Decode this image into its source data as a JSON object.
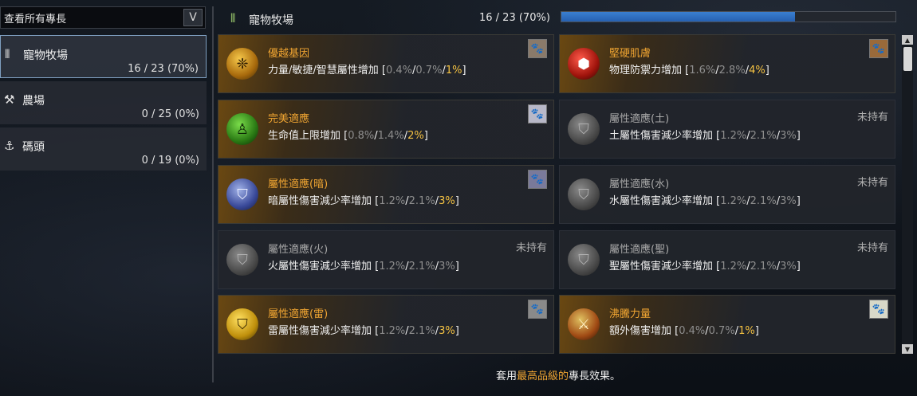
{
  "filter": {
    "label": "查看所有專長",
    "arrow": "V"
  },
  "categories": [
    {
      "icon": "pet-ranch-icon",
      "glyph": "⫴",
      "label": "寵物牧場",
      "count": "16 / 23 (70%)"
    },
    {
      "icon": "farm-icon",
      "glyph": "⚒",
      "label": "農場",
      "count": "0 / 25 (0%)"
    },
    {
      "icon": "anchor-icon",
      "glyph": "⚓",
      "label": "碼頭",
      "count": "0 / 19 (0%)"
    }
  ],
  "header": {
    "title": "寵物牧場",
    "count": "16 / 23 (70%)",
    "progress": 0.7
  },
  "cards": [
    {
      "name": "優越基因",
      "owned": true,
      "effect": "力量/敏捷/智慧屬性增加",
      "v1": "0.4%",
      "v2": "0.7%",
      "v3": "1%",
      "icon": "gene-icon",
      "thumb": "pet-thumb-owl-icon"
    },
    {
      "name": "堅硬肌膚",
      "owned": true,
      "effect": "物理防禦力增加",
      "v1": "1.6%",
      "v2": "2.8%",
      "v3": "4%",
      "icon": "red-gem-icon",
      "thumb": "pet-thumb-tiger-icon"
    },
    {
      "name": "完美適應",
      "owned": true,
      "effect": "生命值上限增加",
      "v1": "0.8%",
      "v2": "1.4%",
      "v3": "2%",
      "icon": "body-aura-icon",
      "thumb": "pet-thumb-cat-icon"
    },
    {
      "name": "屬性適應(土)",
      "owned": false,
      "unowned": "未持有",
      "effect": "土屬性傷害減少率增加",
      "v1": "1.2%",
      "v2": "2.1%",
      "v3": "3%",
      "icon": "shield-icon"
    },
    {
      "name": "屬性適應(暗)",
      "owned": true,
      "effect": "暗屬性傷害減少率增加",
      "v1": "1.2%",
      "v2": "2.1%",
      "v3": "3%",
      "icon": "dark-shield-icon",
      "thumb": "pet-thumb-wolf-icon"
    },
    {
      "name": "屬性適應(水)",
      "owned": false,
      "unowned": "未持有",
      "effect": "水屬性傷害減少率增加",
      "v1": "1.2%",
      "v2": "2.1%",
      "v3": "3%",
      "icon": "shield-icon"
    },
    {
      "name": "屬性適應(火)",
      "owned": false,
      "unowned": "未持有",
      "effect": "火屬性傷害減少率增加",
      "v1": "1.2%",
      "v2": "2.1%",
      "v3": "3%",
      "icon": "shield-icon"
    },
    {
      "name": "屬性適應(聖)",
      "owned": false,
      "unowned": "未持有",
      "effect": "聖屬性傷害減少率增加",
      "v1": "1.2%",
      "v2": "2.1%",
      "v3": "3%",
      "icon": "shield-icon"
    },
    {
      "name": "屬性適應(雷)",
      "owned": true,
      "effect": "雷屬性傷害減少率增加",
      "v1": "1.2%",
      "v2": "2.1%",
      "v3": "3%",
      "icon": "gold-shield-icon",
      "thumb": "pet-thumb-fox-icon"
    },
    {
      "name": "沸騰力量",
      "owned": true,
      "effect": "額外傷害增加",
      "v1": "0.4%",
      "v2": "0.7%",
      "v3": "1%",
      "icon": "crossed-swords-icon",
      "thumb": "pet-thumb-dog-icon"
    }
  ],
  "footer": {
    "prefix": "套用",
    "highlight": "最高品級的",
    "suffix": "專長效果。"
  },
  "colors": {
    "accent": "#f0a532",
    "progress": "#2f6fc4",
    "active_border": "#7f9fc0"
  }
}
